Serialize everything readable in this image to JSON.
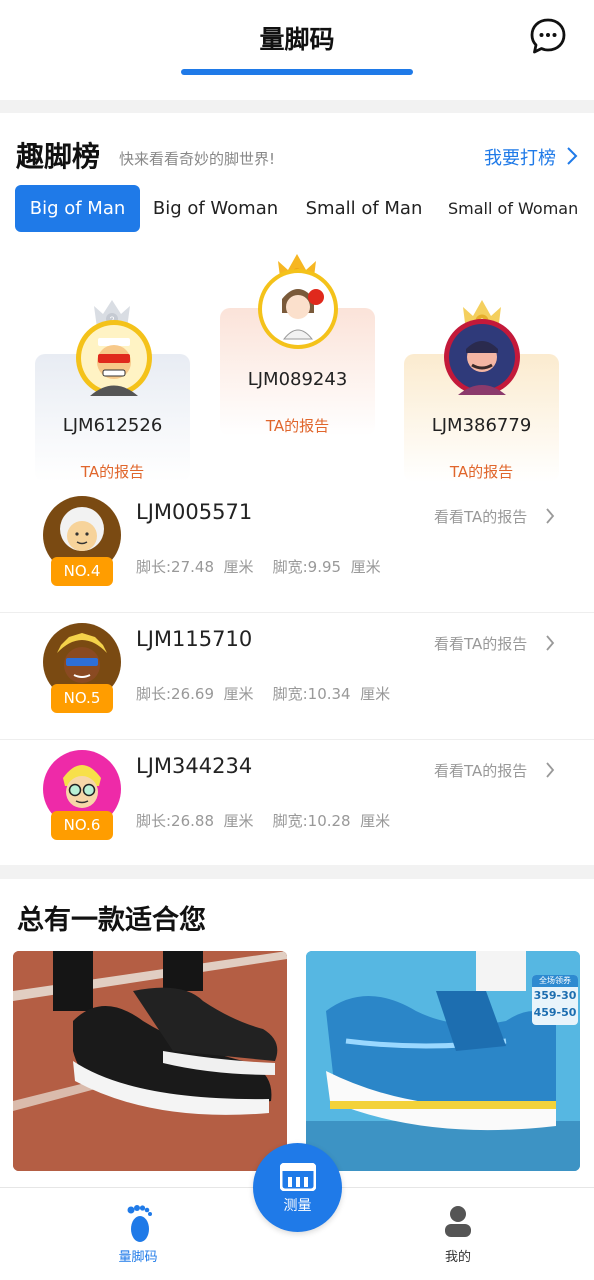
{
  "header": {
    "title": "量脚码"
  },
  "ranking": {
    "title": "趣脚榜",
    "subtitle": "快来看看奇妙的脚世界!",
    "action_label": "我要打榜",
    "tabs": [
      {
        "label": "Big of Man",
        "active": true
      },
      {
        "label": "Big of Woman",
        "active": false
      },
      {
        "label": "Small of Man",
        "active": false
      },
      {
        "label": "Small of Woman",
        "active": false
      }
    ],
    "podium": [
      {
        "rank": 2,
        "name": "LJM612526",
        "report_label": "TA的报告"
      },
      {
        "rank": 1,
        "name": "LJM089243",
        "report_label": "TA的报告"
      },
      {
        "rank": 3,
        "name": "LJM386779",
        "report_label": "TA的报告"
      }
    ],
    "list": [
      {
        "badge": "NO.4",
        "name": "LJM005571",
        "view_label": "看看TA的报告",
        "meta": "脚长:27.48  厘米    脚宽:9.95  厘米"
      },
      {
        "badge": "NO.5",
        "name": "LJM115710",
        "view_label": "看看TA的报告",
        "meta": "脚长:26.69  厘米    脚宽:10.34  厘米"
      },
      {
        "badge": "NO.6",
        "name": "LJM344234",
        "view_label": "看看TA的报告",
        "meta": "脚长:26.88  厘米    脚宽:10.28  厘米"
      }
    ]
  },
  "recommend": {
    "title": "总有一款适合您",
    "tag_line1": "全场领券",
    "tag_line2": "359-30",
    "tag_line3": "459-50"
  },
  "bottom_nav": {
    "items": [
      {
        "label": "量脚码",
        "icon": "foot-icon",
        "active": true
      },
      {
        "label": "我的",
        "icon": "profile-icon",
        "active": false
      }
    ],
    "center_label": "测量",
    "center_icon": "measure-icon"
  },
  "colors": {
    "accent": "#1f7ae8",
    "report": "#e0662c",
    "badge": "#ff9d00"
  }
}
